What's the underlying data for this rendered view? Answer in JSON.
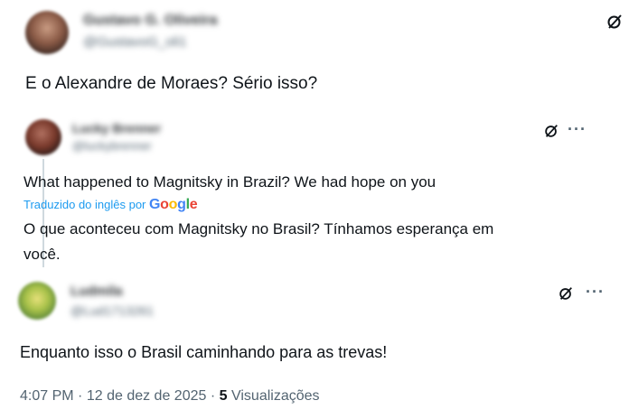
{
  "post1": {
    "display_name": "Gustavo G. Oliveira",
    "handle": "@GustavoG_oli1",
    "text": "E o Alexandre de Moraes? Sério isso?",
    "grok_icon": "grok-icon"
  },
  "post2": {
    "display_name": "Lucky Brenner",
    "handle": "@luckybrenner",
    "text_original": "What happened to Magnitsky in Brazil? We had hope on you",
    "translated_by": "Traduzido do inglês por",
    "translator": "Google",
    "translation_line1": "O que aconteceu com Magnitsky no Brasil? Tínhamos esperança em",
    "translation_line2": "você.",
    "more_icon": "more-icon",
    "colors": {
      "google_blue": "#4285f4",
      "google_red": "#ea4335",
      "google_yellow": "#fbbc05",
      "google_green": "#34a853",
      "link": "#1d9bf0"
    }
  },
  "post3": {
    "display_name": "Ludmila",
    "handle": "@Lud1713261",
    "text": "Enquanto isso o Brasil caminhando para as trevas!",
    "time": "4:07 PM",
    "separator": "·",
    "date": "12 de dez de 2025",
    "views_count": "5",
    "views_label": "Visualizações"
  }
}
